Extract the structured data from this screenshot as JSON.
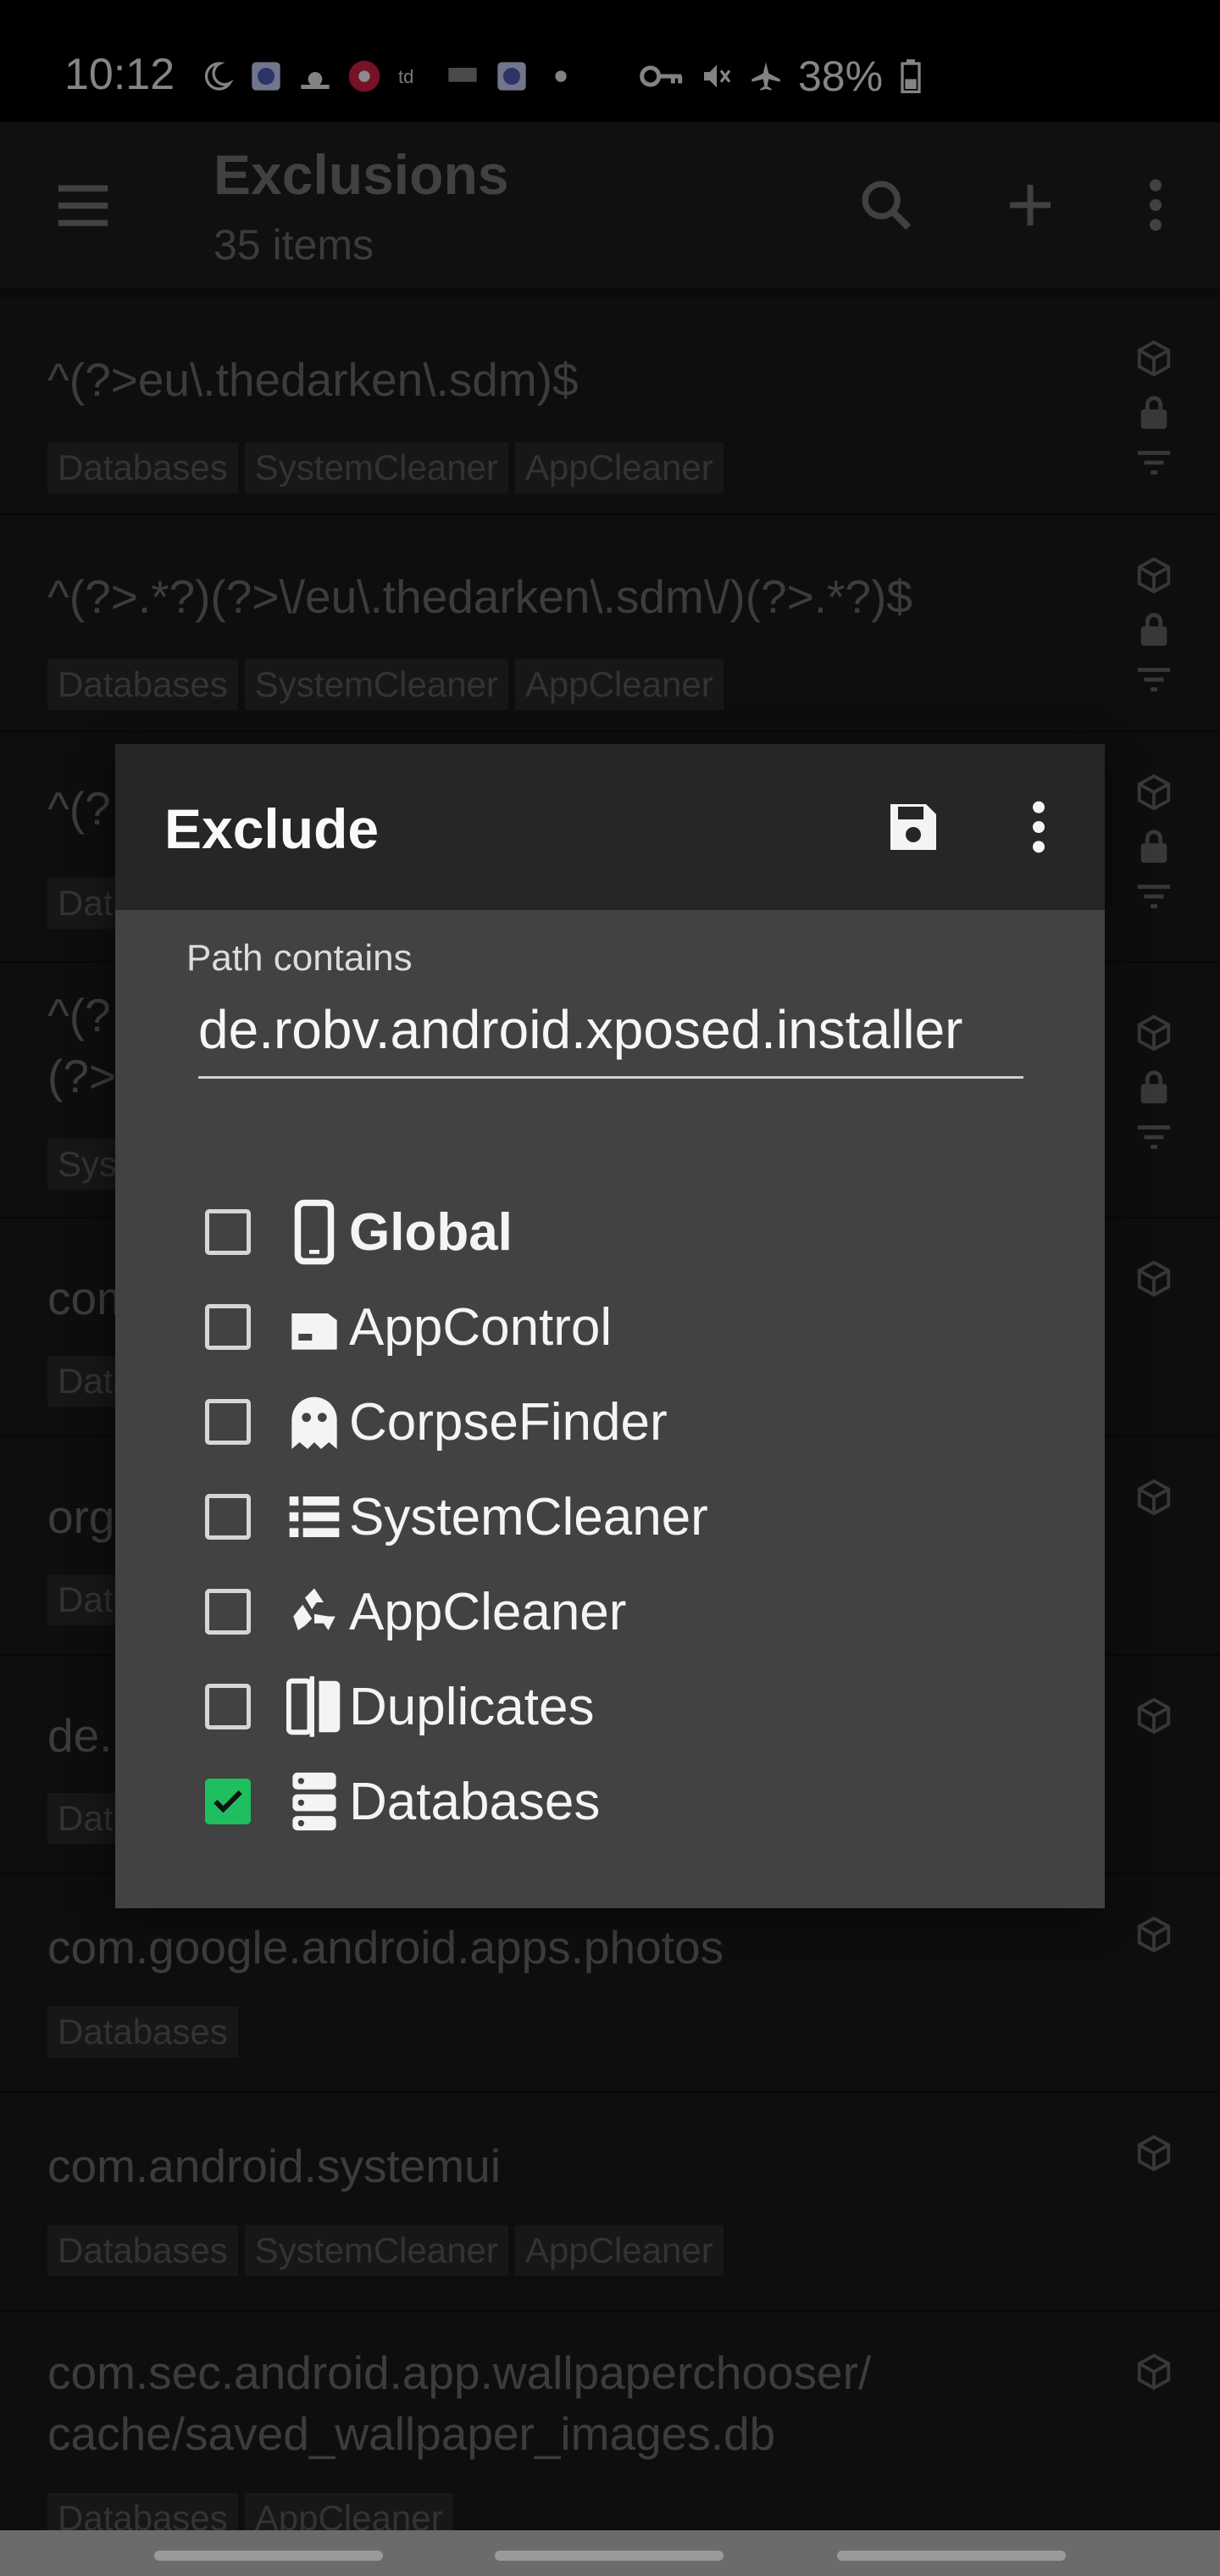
{
  "status_bar": {
    "time": "10:12",
    "battery": "38%"
  },
  "toolbar": {
    "title": "Exclusions",
    "subtitle": "35 items"
  },
  "list": [
    {
      "title": "^(?>eu\\.thedarken\\.sdm)$",
      "tags": [
        "Databases",
        "SystemCleaner",
        "AppCleaner"
      ]
    },
    {
      "title": "^(?>.*?)(?>\\/eu\\.thedarken\\.sdm\\/)(?>.*?)$",
      "tags": [
        "Databases",
        "SystemCleaner",
        "AppCleaner"
      ]
    },
    {
      "title": "^(?",
      "tags": [
        "Dat"
      ]
    },
    {
      "title": "^(?",
      "title2": "(?>",
      "tags": [
        "Sys"
      ]
    },
    {
      "title": "com",
      "tags": [
        "Datab"
      ]
    },
    {
      "title": "org",
      "tags": [
        "Dat"
      ]
    },
    {
      "title": "de.",
      "tags": [
        "Dat"
      ]
    },
    {
      "title": "com.google.android.apps.photos",
      "tags": [
        "Databases"
      ]
    },
    {
      "title": "com.android.systemui",
      "tags": [
        "Databases",
        "SystemCleaner",
        "AppCleaner"
      ]
    },
    {
      "title": "com.sec.android.app.wallpaperchooser/",
      "title2": "cache/saved_wallpaper_images.db",
      "tags": [
        "Databases",
        "AppCleaner"
      ]
    }
  ],
  "dialog": {
    "title": "Exclude",
    "field_label": "Path contains",
    "field_value": "de.robv.android.xposed.installer",
    "options": [
      {
        "label": "Global",
        "icon": "phone-icon",
        "checked": false
      },
      {
        "label": "AppControl",
        "icon": "app-control-icon",
        "checked": false
      },
      {
        "label": "CorpseFinder",
        "icon": "ghost-icon",
        "checked": false
      },
      {
        "label": "SystemCleaner",
        "icon": "list-icon",
        "checked": false
      },
      {
        "label": "AppCleaner",
        "icon": "recycle-icon",
        "checked": false
      },
      {
        "label": "Duplicates",
        "icon": "duplicates-icon",
        "checked": false
      },
      {
        "label": "Databases",
        "icon": "database-icon",
        "checked": true
      }
    ]
  },
  "colors": {
    "accent_check": "#1fbf5f",
    "dialog_bg": "#424242",
    "dialog_header": "#262626"
  }
}
